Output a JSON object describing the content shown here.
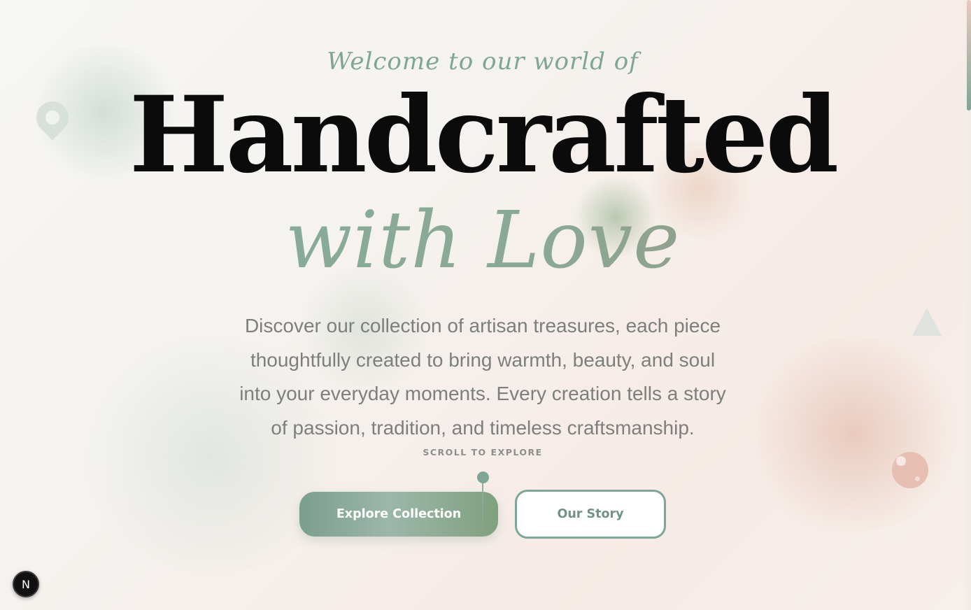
{
  "hero": {
    "welcome": "Welcome to our world of",
    "title_main": "Handcrafted",
    "title_sub": "with Love",
    "description": "Discover our collection of artisan treasures, each piece thoughtfully created to bring warmth, beauty, and soul into your everyday moments. Every creation tells a story of passion, tradition, and timeless craftsmanship.",
    "scroll_label": "SCROLL TO EXPLORE"
  },
  "buttons": {
    "explore_label": "Explore Collection",
    "story_label": "Our Story"
  },
  "dev_badge": {
    "label": "N"
  },
  "decorations": {
    "icons": [
      "map-pin-icon",
      "triangle-icon",
      "bubble-icon"
    ]
  },
  "colors": {
    "accent": "#7fa597",
    "heading": "#0b0b0b",
    "body_text": "#7d7f7e",
    "blush": "#e6bfb2"
  }
}
